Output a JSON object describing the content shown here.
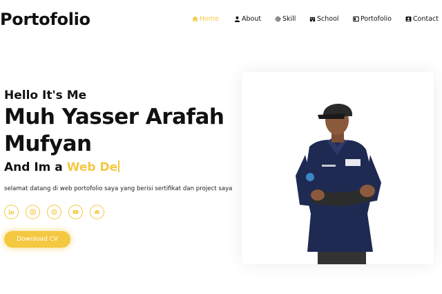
{
  "brand": {
    "logo": "Portofolio"
  },
  "nav": {
    "items": [
      {
        "label": "Home",
        "icon": "home-icon",
        "active": true
      },
      {
        "label": "About",
        "icon": "user-icon",
        "active": false
      },
      {
        "label": "Skill",
        "icon": "gear-icon",
        "active": false
      },
      {
        "label": "School",
        "icon": "school-icon",
        "active": false
      },
      {
        "label": "Portofolio",
        "icon": "portfolio-icon",
        "active": false
      },
      {
        "label": "Contact",
        "icon": "contact-icon",
        "active": false
      }
    ]
  },
  "hero": {
    "greeting": "Hello It's Me",
    "name": "Muh Yasser Arafah Mufyan",
    "role_prefix": "And Im a ",
    "role_typed": "Web De",
    "description": "selamat datang di web portofolio saya yang berisi sertifikat dan project saya",
    "download_label": "Download CV",
    "socials": [
      {
        "icon": "linkedin-icon"
      },
      {
        "icon": "instagram-icon"
      },
      {
        "icon": "github-icon"
      },
      {
        "icon": "youtube-icon"
      },
      {
        "icon": "discord-icon"
      }
    ],
    "photo": {
      "subject": "portrait-photo"
    }
  },
  "colors": {
    "accent": "#f5c842",
    "text": "#111111",
    "background": "#ffffff"
  }
}
